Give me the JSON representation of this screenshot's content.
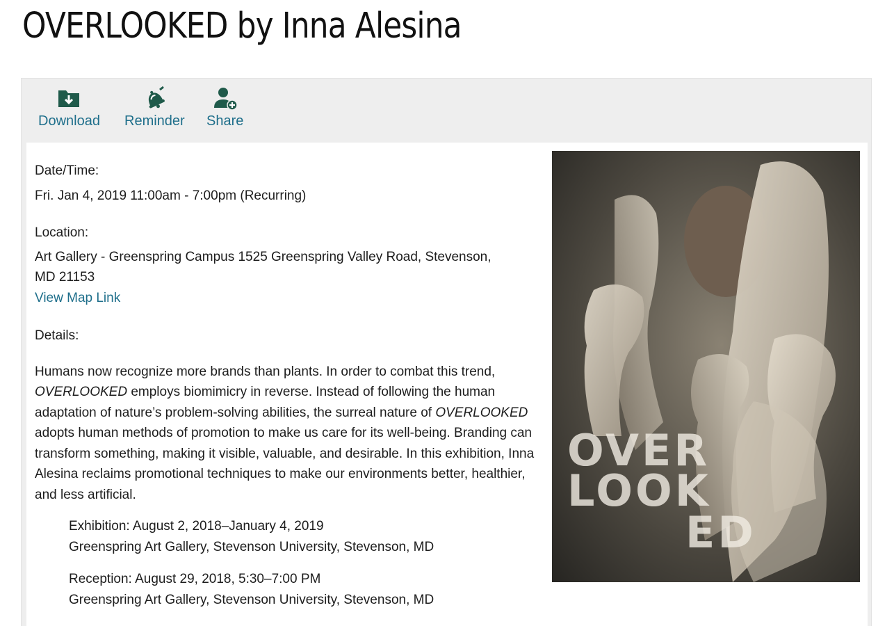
{
  "title": "OVERLOOKED by Inna Alesina",
  "toolbar": {
    "download": {
      "label": "Download",
      "icon": "download-folder-icon"
    },
    "reminder": {
      "label": "Reminder",
      "icon": "bell-icon"
    },
    "share": {
      "label": "Share",
      "icon": "user-add-icon"
    }
  },
  "event": {
    "datetime_label": "Date/Time:",
    "datetime": "Fri. Jan 4, 2019 11:00am - 7:00pm (Recurring)",
    "location_label": "Location:",
    "location_line1": "Art Gallery - Greenspring Campus 1525 Greenspring Valley Road, Stevenson,",
    "location_line2": "MD 21153",
    "map_link": "View Map Link",
    "details_label": "Details:",
    "details": {
      "p1_a": "Humans now recognize more brands than plants. In order to combat this trend,",
      "p1_em1": "OVERLOOKED",
      "p1_b": " employs biomimicry in reverse. Instead of following the human adaptation of nature’s problem-solving abilities, the surreal nature of ",
      "p1_em2": "OVERLOOKED",
      "p1_c": " adopts human methods of promotion to make us care for its well-being. Branding can transform something, making it visible, valuable, and desirable. In this exhibition, Inna Alesina reclaims promotional techniques to make our environments better, healthier, and less artificial."
    },
    "exhibition": {
      "label": "Exhibition:",
      "dates": " August 2, 2018–January 4, 2019",
      "venue": "Greenspring Art Gallery, Stevenson University, Stevenson, MD"
    },
    "reception": {
      "label": "Reception:",
      "dates": " August 29, 2018, 5:30–7:00 PM",
      "venue": "Greenspring Art Gallery, Stevenson University, Stevenson, MD"
    }
  },
  "poster": {
    "text_line1": "OVER",
    "text_line2": "LOOK",
    "text_line3": "ED"
  },
  "colors": {
    "link": "#1f6f8b",
    "icon": "#1f5a4a",
    "panel": "#eeeeee"
  }
}
